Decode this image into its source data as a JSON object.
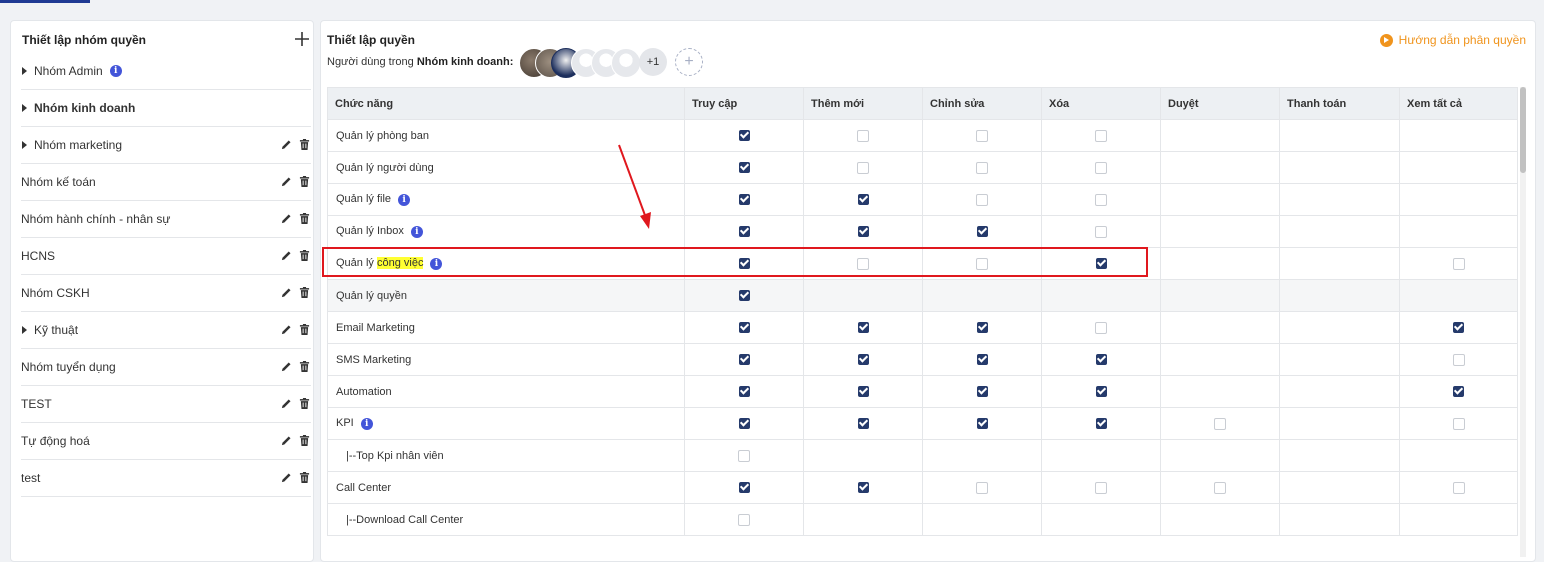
{
  "sidebar": {
    "title": "Thiết lập nhóm quyền",
    "add_icon": "plus-icon",
    "groups": [
      {
        "name": "Nhóm Admin",
        "caret": true,
        "info": true,
        "bold": false,
        "actions": false
      },
      {
        "name": "Nhóm kinh doanh",
        "caret": true,
        "info": false,
        "bold": true,
        "actions": false
      },
      {
        "name": "Nhóm marketing",
        "caret": true,
        "info": false,
        "bold": false,
        "actions": true
      },
      {
        "name": "Nhóm kế toán",
        "caret": false,
        "info": false,
        "bold": false,
        "actions": true
      },
      {
        "name": "Nhóm hành chính - nhân sự",
        "caret": false,
        "info": false,
        "bold": false,
        "actions": true
      },
      {
        "name": "HCNS",
        "caret": false,
        "info": false,
        "bold": false,
        "actions": true
      },
      {
        "name": "Nhóm CSKH",
        "caret": false,
        "info": false,
        "bold": false,
        "actions": true
      },
      {
        "name": "Kỹ thuật",
        "caret": true,
        "info": false,
        "bold": false,
        "actions": true
      },
      {
        "name": "Nhóm tuyển dụng",
        "caret": false,
        "info": false,
        "bold": false,
        "actions": true
      },
      {
        "name": "TEST",
        "caret": false,
        "info": false,
        "bold": false,
        "actions": true
      },
      {
        "name": "Tự động hoá",
        "caret": false,
        "info": false,
        "bold": false,
        "actions": true
      },
      {
        "name": "test",
        "caret": false,
        "info": false,
        "bold": false,
        "actions": true
      }
    ]
  },
  "main": {
    "title": "Thiết lập quyền",
    "users_prefix": "Người dùng trong",
    "group_name": "Nhóm kinh doanh:",
    "more_users": "+1",
    "add_user": "+",
    "guide_link": "Hướng dẫn phân quyền",
    "guide_icon": "play-circle-icon",
    "columns": [
      "Chức năng",
      "Truy cập",
      "Thêm mới",
      "Chỉnh sửa",
      "Xóa",
      "Duyệt",
      "Thanh toán",
      "Xem tất cả"
    ],
    "rows": [
      {
        "name": "Quản lý phòng ban",
        "info": false,
        "cells": [
          1,
          0,
          0,
          0,
          null,
          null,
          null
        ]
      },
      {
        "name": "Quản lý người dùng",
        "info": false,
        "cells": [
          1,
          0,
          0,
          0,
          null,
          null,
          null
        ]
      },
      {
        "name": "Quản lý file",
        "info": true,
        "cells": [
          1,
          1,
          0,
          0,
          null,
          null,
          null
        ]
      },
      {
        "name": "Quản lý Inbox",
        "info": true,
        "cells": [
          1,
          1,
          1,
          0,
          null,
          null,
          null
        ]
      },
      {
        "name": "Quản lý công việc",
        "name_prefix": "Quản lý ",
        "name_highlight": "công việc",
        "info": true,
        "cells": [
          1,
          0,
          0,
          1,
          null,
          null,
          0
        ]
      },
      {
        "name": "Quản lý quyền",
        "info": false,
        "shade": true,
        "cells": [
          1,
          null,
          null,
          null,
          null,
          null,
          null
        ]
      },
      {
        "name": "Email Marketing",
        "info": false,
        "cells": [
          1,
          1,
          1,
          0,
          null,
          null,
          1
        ]
      },
      {
        "name": "SMS Marketing",
        "info": false,
        "cells": [
          1,
          1,
          1,
          1,
          null,
          null,
          0
        ]
      },
      {
        "name": "Automation",
        "info": false,
        "cells": [
          1,
          1,
          1,
          1,
          null,
          null,
          1
        ]
      },
      {
        "name": "KPI",
        "info": true,
        "cells": [
          1,
          1,
          1,
          1,
          0,
          null,
          0
        ]
      },
      {
        "name": "|--Top Kpi nhân viên",
        "info": false,
        "indent": true,
        "cells": [
          0,
          null,
          null,
          null,
          null,
          null,
          null
        ]
      },
      {
        "name": "Call Center",
        "info": false,
        "cells": [
          1,
          1,
          0,
          0,
          0,
          null,
          0
        ]
      },
      {
        "name": "|--Download Call Center",
        "info": false,
        "indent": true,
        "cells": [
          0,
          null,
          null,
          null,
          null,
          null,
          null
        ]
      }
    ]
  },
  "colors": {
    "accent": "#253a6b",
    "highlight_box": "#e0181e",
    "guide": "#f0941d",
    "info": "#4355d9"
  }
}
